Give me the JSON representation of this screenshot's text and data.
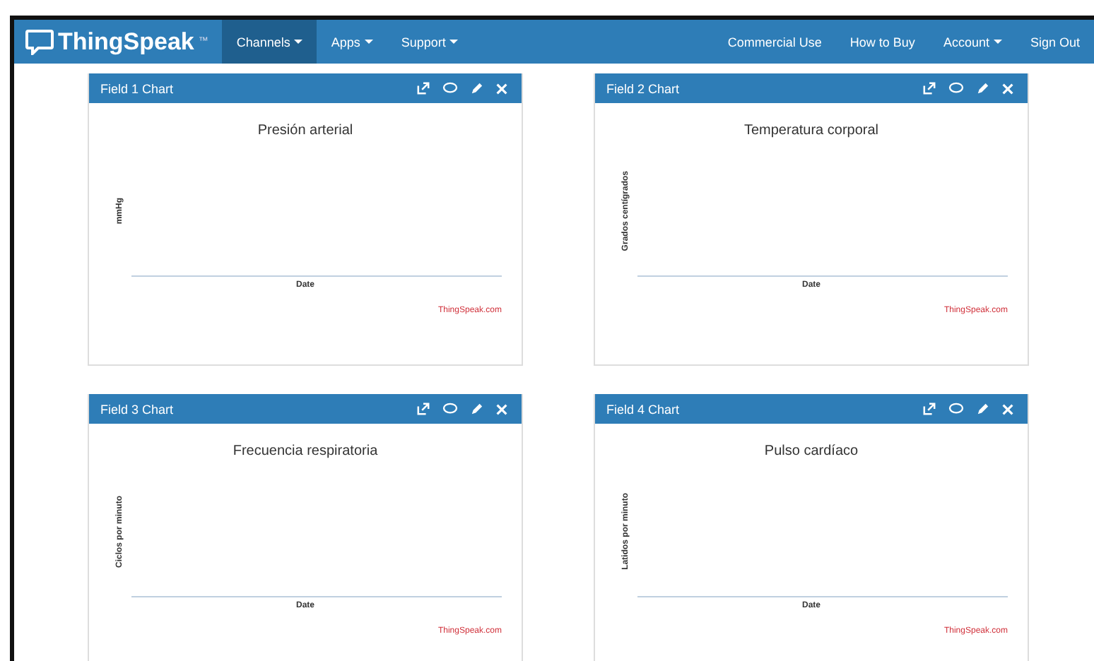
{
  "navbar": {
    "brand": "ThingSpeak",
    "brand_mark": "™",
    "left_items": [
      {
        "label": "Channels",
        "dropdown": true,
        "selected": true
      },
      {
        "label": "Apps",
        "dropdown": true,
        "selected": false
      },
      {
        "label": "Support",
        "dropdown": true,
        "selected": false
      }
    ],
    "right_items": [
      {
        "label": "Commercial Use",
        "dropdown": false,
        "selected": false
      },
      {
        "label": "How to Buy",
        "dropdown": false,
        "selected": false
      },
      {
        "label": "Account",
        "dropdown": true,
        "selected": false
      },
      {
        "label": "Sign Out",
        "dropdown": false,
        "selected": false
      }
    ]
  },
  "panels": [
    {
      "title": "Field 1 Chart",
      "chart_title": "Presión arterial",
      "ylabel": "mmHg",
      "xlabel": "Date",
      "credit": "ThingSpeak.com"
    },
    {
      "title": "Field 2 Chart",
      "chart_title": "Temperatura corporal",
      "ylabel": "Grados centígrados",
      "xlabel": "Date",
      "credit": "ThingSpeak.com"
    },
    {
      "title": "Field 3 Chart",
      "chart_title": "Frecuencia respiratoria",
      "ylabel": "Ciclos por minuto",
      "xlabel": "Date",
      "credit": "ThingSpeak.com"
    },
    {
      "title": "Field 4 Chart",
      "chart_title": "Pulso cardíaco",
      "ylabel": "Latidos por minuto",
      "xlabel": "Date",
      "credit": "ThingSpeak.com"
    }
  ]
}
